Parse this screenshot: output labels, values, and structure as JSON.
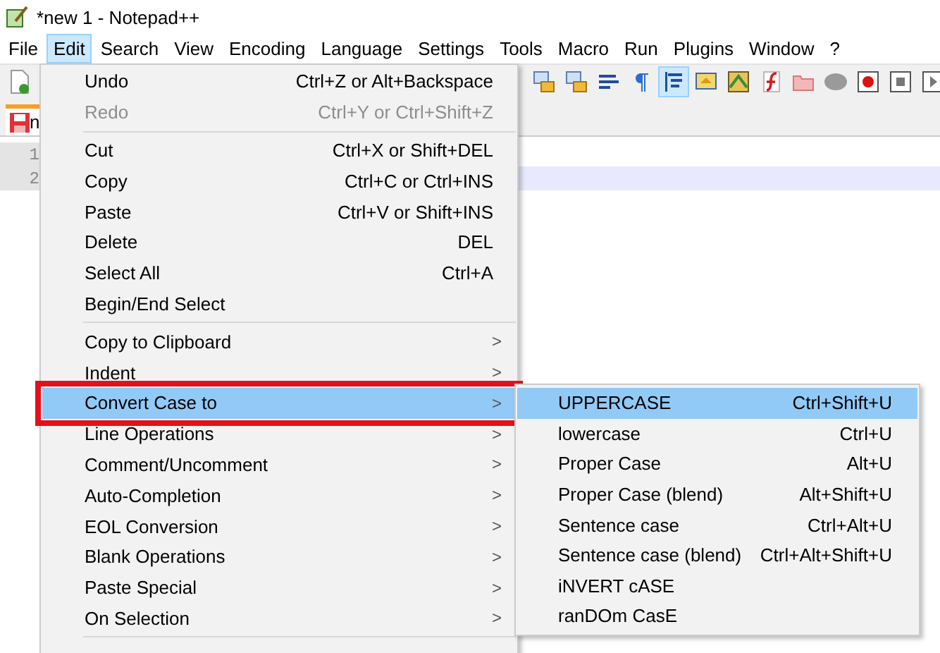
{
  "window": {
    "title": "*new 1 - Notepad++"
  },
  "menubar": [
    {
      "label": "File",
      "selected": false
    },
    {
      "label": "Edit",
      "selected": true
    },
    {
      "label": "Search",
      "selected": false
    },
    {
      "label": "View",
      "selected": false
    },
    {
      "label": "Encoding",
      "selected": false
    },
    {
      "label": "Language",
      "selected": false
    },
    {
      "label": "Settings",
      "selected": false
    },
    {
      "label": "Tools",
      "selected": false
    },
    {
      "label": "Macro",
      "selected": false
    },
    {
      "label": "Run",
      "selected": false
    },
    {
      "label": "Plugins",
      "selected": false
    },
    {
      "label": "Window",
      "selected": false
    },
    {
      "label": "?",
      "selected": false
    }
  ],
  "toolbar": [
    {
      "kind": "lock",
      "on": false
    },
    {
      "kind": "lock",
      "on": false
    },
    {
      "kind": "wrap",
      "on": false
    },
    {
      "kind": "pilcrow",
      "on": false
    },
    {
      "kind": "indent",
      "on": true
    },
    {
      "kind": "fold",
      "on": false
    },
    {
      "kind": "map",
      "on": false
    },
    {
      "kind": "function",
      "on": false
    },
    {
      "kind": "folder",
      "on": false
    },
    {
      "kind": "cloud",
      "on": false
    },
    {
      "kind": "record",
      "on": false
    },
    {
      "kind": "stop",
      "on": false
    },
    {
      "kind": "play",
      "on": false
    }
  ],
  "tab": {
    "label": "n"
  },
  "editor": {
    "lines": [
      {
        "number": "1",
        "current": false
      },
      {
        "number": "2",
        "current": true
      }
    ]
  },
  "edit_menu": [
    {
      "kind": "item",
      "label": "Undo",
      "shortcut": "Ctrl+Z or Alt+Backspace",
      "disabled": false,
      "selected": false,
      "outlined": false
    },
    {
      "kind": "item",
      "label": "Redo",
      "shortcut": "Ctrl+Y or Ctrl+Shift+Z",
      "disabled": true,
      "selected": false,
      "outlined": false
    },
    {
      "kind": "separator"
    },
    {
      "kind": "item",
      "label": "Cut",
      "shortcut": "Ctrl+X or Shift+DEL",
      "disabled": false,
      "selected": false,
      "outlined": false
    },
    {
      "kind": "item",
      "label": "Copy",
      "shortcut": "Ctrl+C or Ctrl+INS",
      "disabled": false,
      "selected": false,
      "outlined": false
    },
    {
      "kind": "item",
      "label": "Paste",
      "shortcut": "Ctrl+V or Shift+INS",
      "disabled": false,
      "selected": false,
      "outlined": false
    },
    {
      "kind": "item",
      "label": "Delete",
      "shortcut": "DEL",
      "disabled": false,
      "selected": false,
      "outlined": false
    },
    {
      "kind": "item",
      "label": "Select All",
      "shortcut": "Ctrl+A",
      "disabled": false,
      "selected": false,
      "outlined": false
    },
    {
      "kind": "item",
      "label": "Begin/End Select",
      "disabled": false,
      "selected": false,
      "outlined": false
    },
    {
      "kind": "separator"
    },
    {
      "kind": "submenu",
      "label": "Copy to Clipboard",
      "arrow": ">",
      "disabled": false,
      "selected": false,
      "outlined": false
    },
    {
      "kind": "submenu",
      "label": "Indent",
      "arrow": ">",
      "disabled": false,
      "selected": false,
      "outlined": false
    },
    {
      "kind": "submenu",
      "label": "Convert Case to",
      "arrow": ">",
      "disabled": false,
      "selected": true,
      "outlined": true
    },
    {
      "kind": "submenu",
      "label": "Line Operations",
      "arrow": ">",
      "disabled": false,
      "selected": false,
      "outlined": false
    },
    {
      "kind": "submenu",
      "label": "Comment/Uncomment",
      "arrow": ">",
      "disabled": false,
      "selected": false,
      "outlined": false
    },
    {
      "kind": "submenu",
      "label": "Auto-Completion",
      "arrow": ">",
      "disabled": false,
      "selected": false,
      "outlined": false
    },
    {
      "kind": "submenu",
      "label": "EOL Conversion",
      "arrow": ">",
      "disabled": false,
      "selected": false,
      "outlined": false
    },
    {
      "kind": "submenu",
      "label": "Blank Operations",
      "arrow": ">",
      "disabled": false,
      "selected": false,
      "outlined": false
    },
    {
      "kind": "submenu",
      "label": "Paste Special",
      "arrow": ">",
      "disabled": false,
      "selected": false,
      "outlined": false
    },
    {
      "kind": "submenu",
      "label": "On Selection",
      "arrow": ">",
      "disabled": false,
      "selected": false,
      "outlined": false
    },
    {
      "kind": "separator"
    }
  ],
  "convert_case_menu": [
    {
      "label": "UPPERCASE",
      "shortcut": "Ctrl+Shift+U",
      "selected": true
    },
    {
      "label": "lowercase",
      "shortcut": "Ctrl+U",
      "selected": false
    },
    {
      "label": "Proper Case",
      "shortcut": "Alt+U",
      "selected": false
    },
    {
      "label": "Proper Case (blend)",
      "shortcut": "Alt+Shift+U",
      "selected": false
    },
    {
      "label": "Sentence case",
      "shortcut": "Ctrl+Alt+U",
      "selected": false
    },
    {
      "label": "Sentence case (blend)",
      "shortcut": "Ctrl+Alt+Shift+U",
      "selected": false
    },
    {
      "label": "iNVERT cASE",
      "selected": false
    },
    {
      "label": "ranDOm CasE",
      "selected": false
    }
  ]
}
